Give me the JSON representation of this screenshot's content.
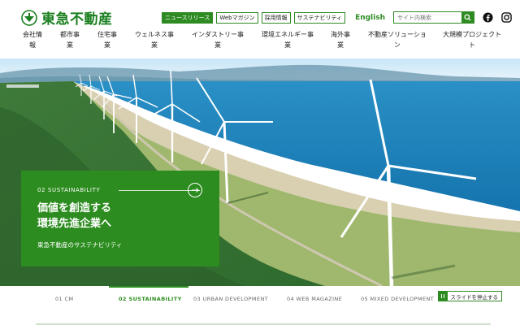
{
  "brand": {
    "name": "東急不動産",
    "color": "#1a7f1f"
  },
  "utility": {
    "buttons": [
      "ニュースリリース",
      "Webマガジン",
      "採用情報",
      "サステナビリティ"
    ],
    "active_index": 0,
    "language_label": "English",
    "search_placeholder": "サイト内検索"
  },
  "nav": {
    "items": [
      "会社情\n報",
      "都市事\n業",
      "住宅事\n業",
      "ウェルネス事\n業",
      "インダストリー事\n業",
      "環境エネルギー事\n業",
      "海外事\n業",
      "不動産ソリューショ\nン",
      "大規模プロジェクト\nト"
    ]
  },
  "hero": {
    "label": "02 SUSTAINABILITY",
    "heading_line1": "価値を創造する",
    "heading_line2": "環境先進企業へ",
    "subtitle": "東急不動産のサステナビリティ"
  },
  "slides": {
    "tabs": [
      "01 CM",
      "02 SUSTAINABILITY",
      "03 URBAN DEVELOPMENT",
      "04 WEB MAGAZINE",
      "05 MIXED DEVELOPMENT"
    ],
    "active_index": 1,
    "pause_label": "スライドを停止する"
  },
  "icons": {
    "logo": "tokyu-logo-icon",
    "search": "search-icon",
    "facebook": "facebook-icon",
    "instagram": "instagram-icon",
    "arrow": "arrow-right-icon",
    "pause": "pause-icon"
  },
  "colors": {
    "accent": "#2c8c1f",
    "sky": "#a9d4f0",
    "sea": "#1f8fc0"
  }
}
